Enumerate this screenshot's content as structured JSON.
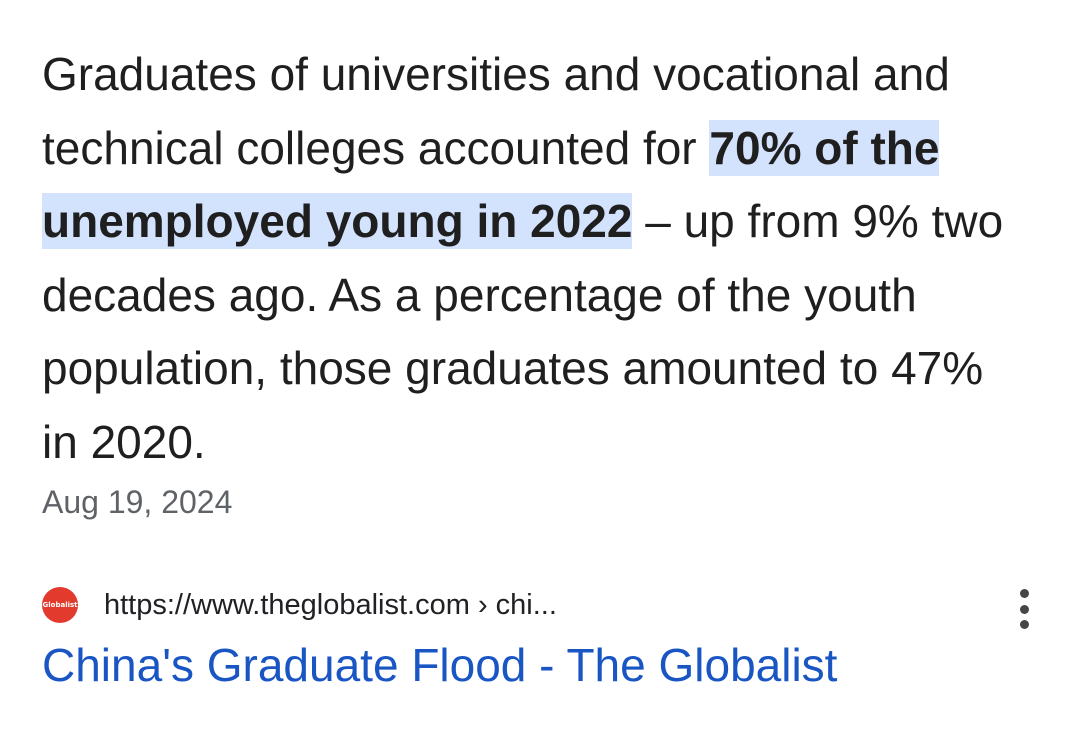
{
  "snippet": {
    "before": "Graduates of universities and vocational and technical colleges accounted for ",
    "highlight": "70% of the unemployed young in 2022",
    "after": " – up from 9% two decades ago. As a percentage of the youth population, those graduates amounted to 47% in 2020."
  },
  "date": "Aug 19, 2024",
  "source": {
    "favicon_text": "Globalist",
    "favicon_color": "#e23b2e",
    "url": "https://www.theglobalist.com › chi...",
    "more_icon": "more-vert-icon"
  },
  "result": {
    "title": "China's Graduate Flood - The Globalist",
    "link_color": "#1a55c4"
  },
  "colors": {
    "highlight_bg": "#d3e3fd",
    "text": "#1f1f1f",
    "muted": "#5f6368"
  }
}
